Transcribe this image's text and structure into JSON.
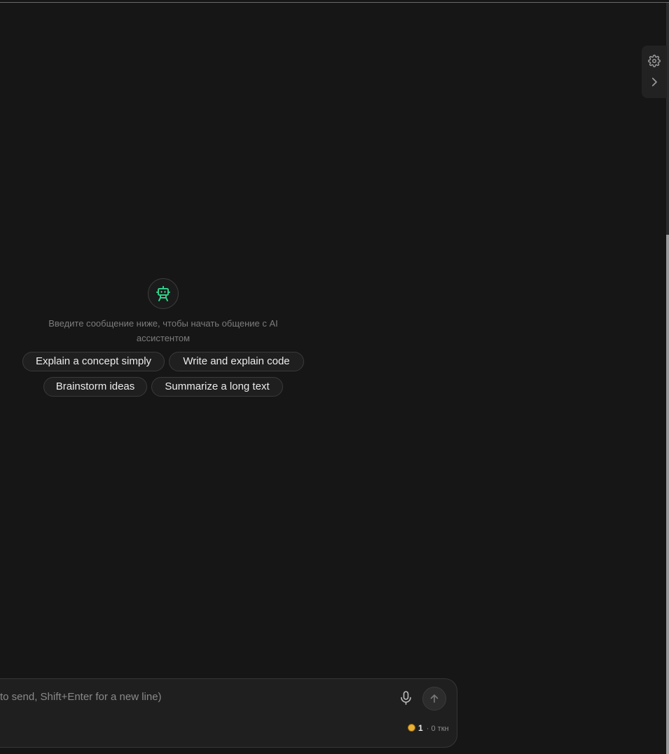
{
  "empty_state": {
    "hint_line1": "Введите сообщение ниже, чтобы начать общение с AI",
    "hint_line2": "ассистентом",
    "suggestions": [
      "Explain a concept simply",
      "Write and explain code",
      "Brainstorm ideas",
      "Summarize a long text"
    ]
  },
  "composer": {
    "placeholder": "to send, Shift+Enter for a new line)",
    "coins": "1",
    "separator": "·",
    "tokens": "0 ткн"
  },
  "icons": {
    "settings": "gear-icon",
    "collapse": "chevron-right-icon",
    "assistant": "robot-icon",
    "voice": "microphone-icon",
    "send": "arrow-up-icon",
    "coin": "coin-icon"
  },
  "colors": {
    "background": "#161616",
    "accent": "#2fd08a",
    "chip_border": "#3a3a3a",
    "coin": "#e9b236"
  }
}
